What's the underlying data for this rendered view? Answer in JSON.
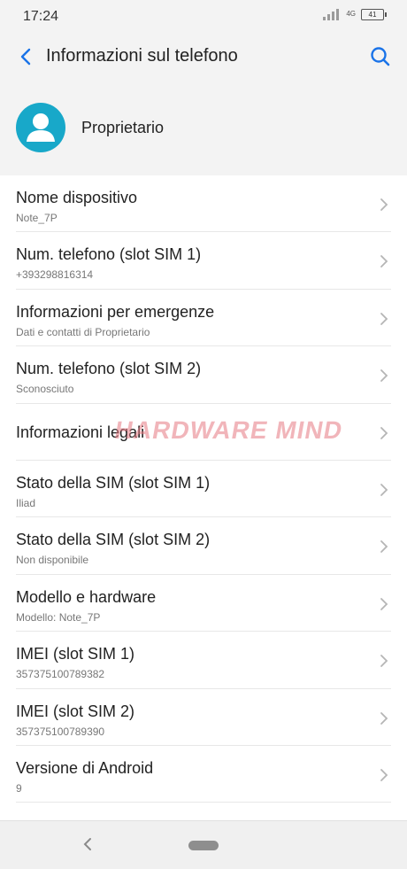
{
  "status": {
    "time": "17:24",
    "network": "4G",
    "battery": "41"
  },
  "header": {
    "title": "Informazioni sul telefono",
    "owner": "Proprietario"
  },
  "items": [
    {
      "title": "Nome dispositivo",
      "subtitle": "Note_7P"
    },
    {
      "title": "Num. telefono (slot SIM 1)",
      "subtitle": "+393298816314"
    },
    {
      "title": "Informazioni per emergenze",
      "subtitle": "Dati e contatti di Proprietario"
    },
    {
      "title": "Num. telefono (slot SIM 2)",
      "subtitle": "Sconosciuto"
    },
    {
      "title": "Informazioni legali",
      "subtitle": ""
    },
    {
      "title": "Stato della SIM (slot SIM 1)",
      "subtitle": "Iliad"
    },
    {
      "title": "Stato della SIM (slot SIM 2)",
      "subtitle": "Non disponibile"
    },
    {
      "title": "Modello e hardware",
      "subtitle": "Modello: Note_7P"
    },
    {
      "title": "IMEI (slot SIM 1)",
      "subtitle": "357375100789382"
    },
    {
      "title": "IMEI (slot SIM 2)",
      "subtitle": "357375100789390"
    },
    {
      "title": "Versione di Android",
      "subtitle": "9"
    }
  ],
  "watermark": "HARDWARE MIND",
  "colors": {
    "accent": "#1a73e8",
    "avatar": "#18a8c9"
  }
}
